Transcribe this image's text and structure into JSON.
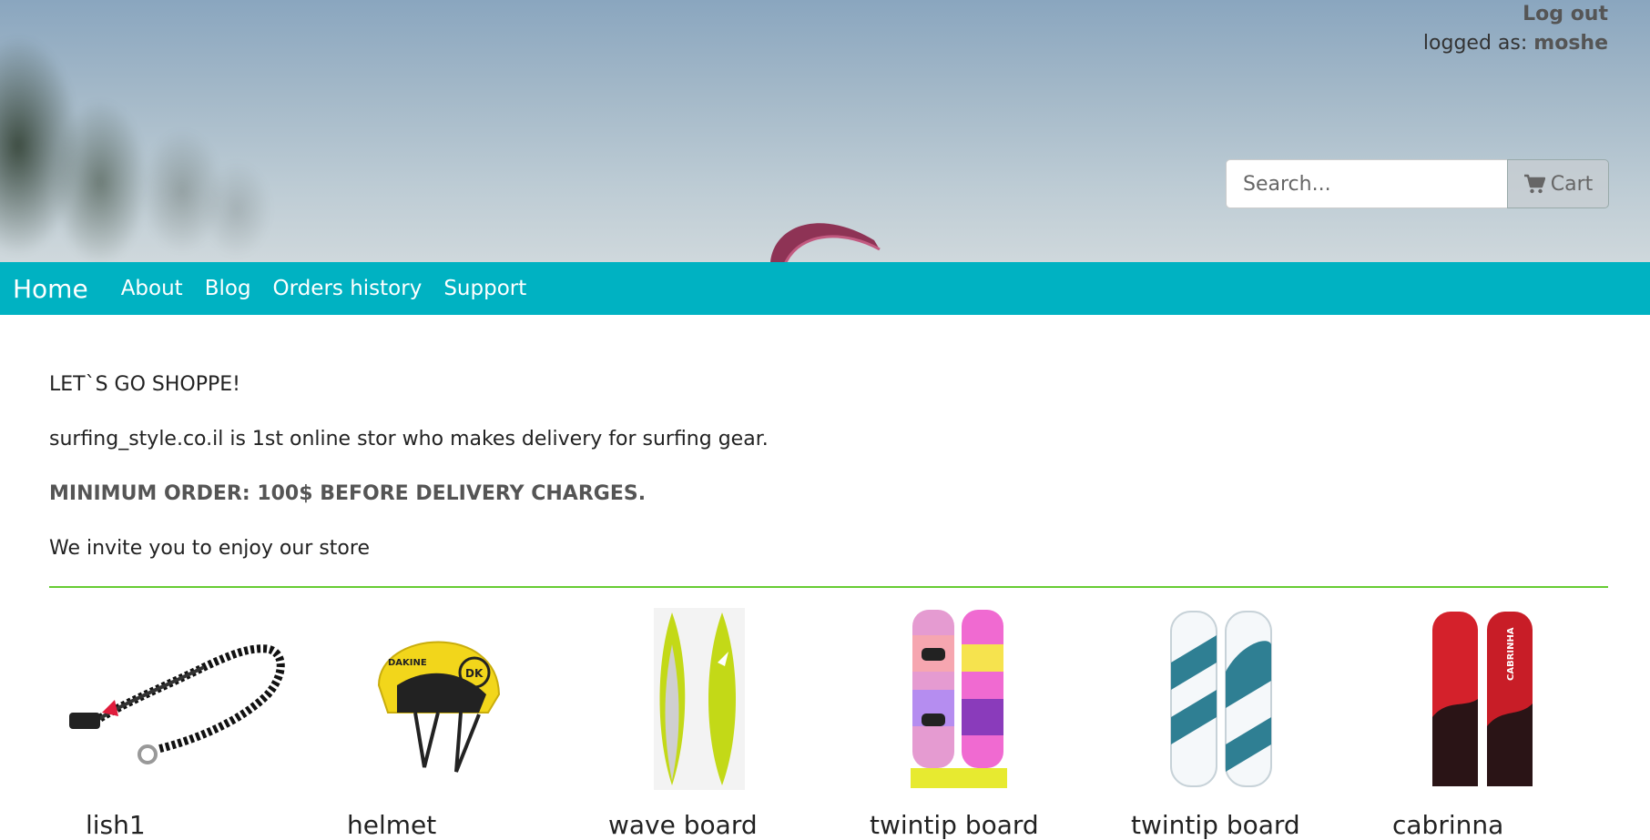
{
  "header": {
    "logout_label": "Log out",
    "logged_as_label": "logged as:",
    "username": "moshe",
    "search_placeholder": "Search...",
    "cart_label": "Cart"
  },
  "nav": {
    "brand": "Home",
    "links": [
      "About",
      "Blog",
      "Orders history",
      "Support"
    ]
  },
  "intro": {
    "headline": "LET`S GO SHOPPE!",
    "description": "surfing_style.co.il is 1st online stor who makes delivery for surfing gear.",
    "minimum_order": "MINIMUM ORDER: 100$ BEFORE DELIVERY CHARGES.",
    "invite": "We invite you to enjoy our store"
  },
  "products": [
    {
      "name": "lish1",
      "icon": "leash-image"
    },
    {
      "name": "helmet",
      "icon": "helmet-image"
    },
    {
      "name": "wave board",
      "icon": "wave-board-image"
    },
    {
      "name": "twintip board",
      "icon": "twintip-board-image"
    },
    {
      "name": "twintip board",
      "icon": "twintip-board-image"
    },
    {
      "name": "cabrinna",
      "icon": "cabrinha-board-image"
    }
  ],
  "colors": {
    "navbar": "#00b2c2",
    "divider": "#66cc33"
  }
}
